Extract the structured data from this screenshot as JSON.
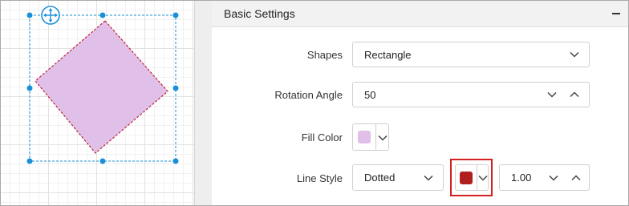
{
  "panel": {
    "title": "Basic Settings"
  },
  "fields": {
    "shapes": {
      "label": "Shapes",
      "value": "Rectangle"
    },
    "rotation": {
      "label": "Rotation Angle",
      "value": "50"
    },
    "fill": {
      "label": "Fill Color",
      "color": "#e0c0e8"
    },
    "line_style": {
      "label": "Line Style",
      "value": "Dotted",
      "color": "#b01e1e",
      "width": "1.00"
    }
  },
  "canvas": {
    "shape_fill": "#e0c0e8",
    "shape_stroke": "#c0203a",
    "selection_color": "#1a90d8"
  }
}
